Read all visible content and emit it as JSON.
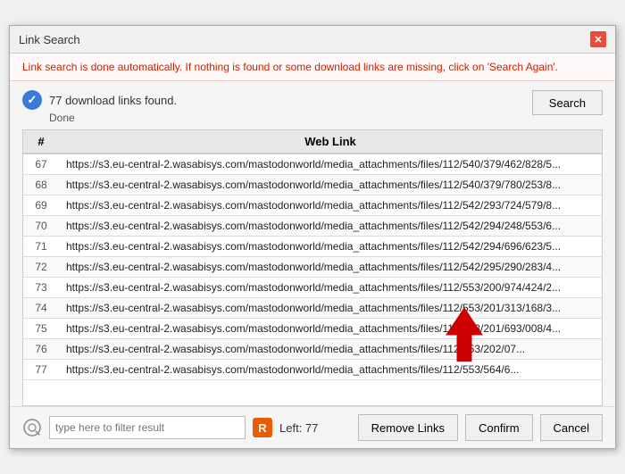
{
  "dialog": {
    "title": "Link Search",
    "close_label": "✕",
    "info_text": "Link search is done automatically. If nothing is found or some download links are missing, click on 'Search Again'.",
    "status": {
      "found_text": "77 download links found.",
      "done_label": "Done",
      "check_symbol": "✓"
    },
    "search_button": "Search",
    "table": {
      "headers": [
        "#",
        "Web Link"
      ],
      "rows": [
        {
          "num": "67",
          "url": "https://s3.eu-central-2.wasabisys.com/mastodonworld/media_attachments/files/112/540/379/462/828/5..."
        },
        {
          "num": "68",
          "url": "https://s3.eu-central-2.wasabisys.com/mastodonworld/media_attachments/files/112/540/379/780/253/8..."
        },
        {
          "num": "69",
          "url": "https://s3.eu-central-2.wasabisys.com/mastodonworld/media_attachments/files/112/542/293/724/579/8..."
        },
        {
          "num": "70",
          "url": "https://s3.eu-central-2.wasabisys.com/mastodonworld/media_attachments/files/112/542/294/248/553/6..."
        },
        {
          "num": "71",
          "url": "https://s3.eu-central-2.wasabisys.com/mastodonworld/media_attachments/files/112/542/294/696/623/5..."
        },
        {
          "num": "72",
          "url": "https://s3.eu-central-2.wasabisys.com/mastodonworld/media_attachments/files/112/542/295/290/283/4..."
        },
        {
          "num": "73",
          "url": "https://s3.eu-central-2.wasabisys.com/mastodonworld/media_attachments/files/112/553/200/974/424/2..."
        },
        {
          "num": "74",
          "url": "https://s3.eu-central-2.wasabisys.com/mastodonworld/media_attachments/files/112/553/201/313/168/3..."
        },
        {
          "num": "75",
          "url": "https://s3.eu-central-2.wasabisys.com/mastodonworld/media_attachments/files/112/553/201/693/008/4..."
        },
        {
          "num": "76",
          "url": "https://s3.eu-central-2.wasabisys.com/mastodonworld/media_attachments/files/112/553/202/07..."
        },
        {
          "num": "77",
          "url": "https://s3.eu-central-2.wasabisys.com/mastodonworld/media_attachments/files/112/553/564/6..."
        }
      ]
    },
    "bottom": {
      "filter_placeholder": "type here to filter result",
      "r_label": "R",
      "left_label": "Left: 77",
      "remove_links_btn": "Remove Links",
      "confirm_btn": "Confirm",
      "cancel_btn": "Cancel"
    }
  }
}
